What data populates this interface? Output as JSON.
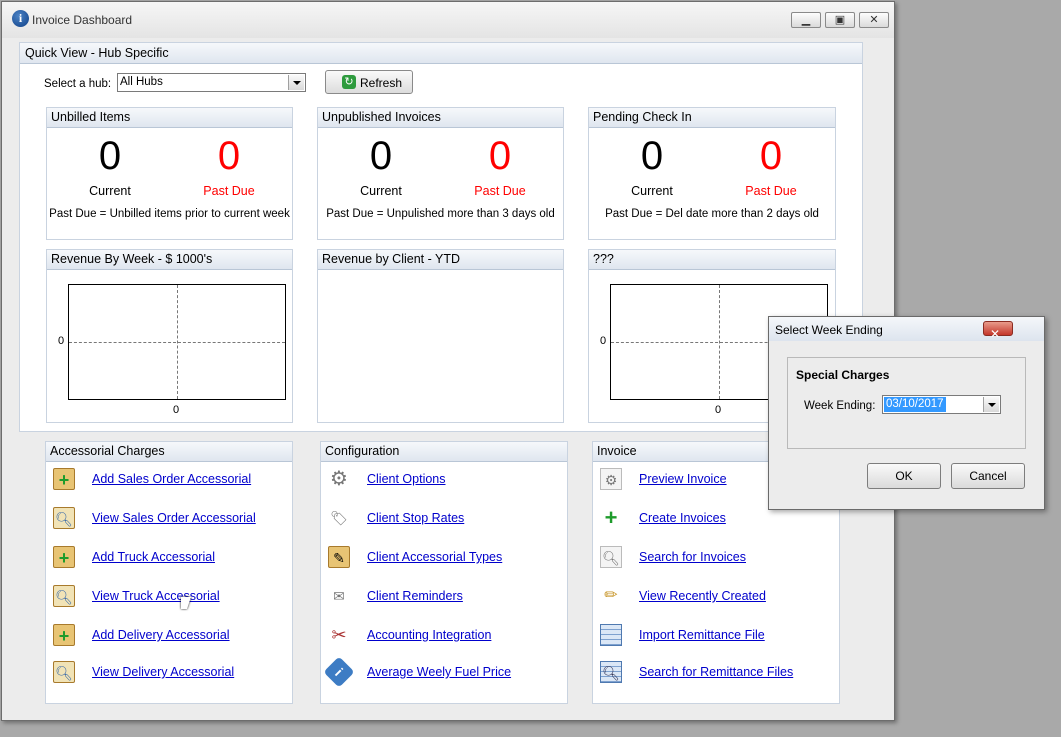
{
  "window": {
    "title": "Invoice Dashboard"
  },
  "quick_view": {
    "title": "Quick View - Hub Specific",
    "hub_label": "Select a hub:",
    "hub_value": "All Hubs",
    "refresh_label": "Refresh"
  },
  "stats": [
    {
      "title": "Unbilled Items",
      "current": "0",
      "current_label": "Current",
      "past_due": "0",
      "past_due_label": "Past Due",
      "note": "Past Due = Unbilled items prior to current week"
    },
    {
      "title": "Unpublished Invoices",
      "current": "0",
      "current_label": "Current",
      "past_due": "0",
      "past_due_label": "Past Due",
      "note": "Past Due = Unpulished more than 3 days old"
    },
    {
      "title": "Pending Check In",
      "current": "0",
      "current_label": "Current",
      "past_due": "0",
      "past_due_label": "Past Due",
      "note": "Past Due = Del date more than 2 days old"
    }
  ],
  "charts": [
    {
      "title": "Revenue By Week - $ 1000's",
      "x_tick": "0",
      "y_tick": "0"
    },
    {
      "title": "Revenue by Client - YTD"
    },
    {
      "title": "???",
      "x_tick": "0",
      "y_tick": "0"
    }
  ],
  "accessorial": {
    "title": "Accessorial Charges",
    "links": [
      {
        "label": "Add Sales Order Accessorial",
        "icon": "clipboard-plus-icon"
      },
      {
        "label": "View Sales Order Accessorial",
        "icon": "clipboard-magnify-icon"
      },
      {
        "label": "Add Truck Accessorial",
        "icon": "clipboard-plus-icon"
      },
      {
        "label": "View Truck Accessorial",
        "icon": "clipboard-magnify-icon"
      },
      {
        "label": "Add Delivery Accessorial",
        "icon": "clipboard-plus-icon"
      },
      {
        "label": "View Delivery Accessorial",
        "icon": "clipboard-magnify-icon"
      }
    ]
  },
  "configuration": {
    "title": "Configuration",
    "links": [
      {
        "label": "Client Options",
        "icon": "gear-icon"
      },
      {
        "label": "Client Stop Rates",
        "icon": "tag-icon"
      },
      {
        "label": "Client Accessorial Types",
        "icon": "clipboard-edit-icon"
      },
      {
        "label": "Client Reminders",
        "icon": "note-icon"
      },
      {
        "label": "Accounting Integration",
        "icon": "tools-icon"
      },
      {
        "label": "Average Weely Fuel Price",
        "icon": "info-icon"
      }
    ]
  },
  "invoice": {
    "title": "Invoice",
    "links": [
      {
        "label": "Preview Invoice",
        "icon": "preview-icon"
      },
      {
        "label": "Create Invoices",
        "icon": "plus-icon"
      },
      {
        "label": "Search for Invoices",
        "icon": "magnify-icon"
      },
      {
        "label": "View Recently Created",
        "icon": "pencil-icon"
      },
      {
        "label": "Import Remittance File",
        "icon": "table-icon"
      },
      {
        "label": "Search for Remittance Files",
        "icon": "search-table-icon"
      }
    ]
  },
  "dialog": {
    "title": "Select Week Ending",
    "group_title": "Special Charges",
    "week_label": "Week Ending:",
    "week_value": "03/10/2017",
    "ok_label": "OK",
    "cancel_label": "Cancel"
  }
}
